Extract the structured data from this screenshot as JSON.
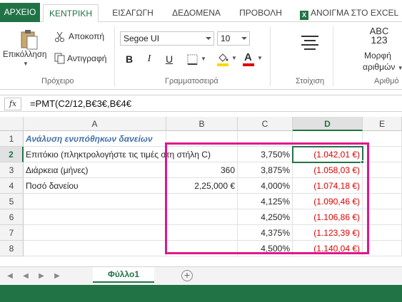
{
  "tabs": {
    "file": "ΑΡΧΕΙΟ",
    "home": "ΚΕΝΤΡΙΚΗ",
    "insert": "ΕΙΣΑΓΩΓΗ",
    "data": "ΔΕΔΟΜΕΝΑ",
    "view": "ΠΡΟΒΟΛΗ",
    "open_in_excel": "ΑΝΟΙΓΜΑ ΣΤΟ EXCEL"
  },
  "ribbon": {
    "clipboard": {
      "paste_label": "Επικόλληση",
      "cut_label": "Αποκοπή",
      "copy_label": "Αντιγραφή",
      "group_label": "Πρόχειρο"
    },
    "font": {
      "font_name": "Segoe UI",
      "font_size": "10",
      "bold": "B",
      "italic": "I",
      "underline": "U",
      "font_color_glyph": "A",
      "group_label": "Γραμματοσειρά"
    },
    "alignment": {
      "group_label": "Στοίχιση"
    },
    "number": {
      "icon_text_top": "ABC",
      "icon_text_bottom": "123",
      "format_label_1": "Μορφή",
      "format_label_2": "αριθμών",
      "group_label": "Αριθμό"
    },
    "colors": {
      "accent": "#217346",
      "highlight": "#ffd700",
      "font_color": "#e00000"
    }
  },
  "formula_bar": {
    "fx": "fx",
    "formula": "=PMT(C2/12,B€3€,B€4€"
  },
  "sheet": {
    "columns": [
      "A",
      "B",
      "C",
      "D",
      "E"
    ],
    "rows": [
      "1",
      "2",
      "3",
      "4",
      "5",
      "6",
      "7",
      "8"
    ],
    "active_column": "D",
    "active_row": "2",
    "cells": {
      "a1": "Ανάλυση ενυπόθηκων δανείων",
      "a2": "Επιτόκιο (πληκτρολογήστε τις τιμές στη στήλη C)",
      "a3": "Διάρκεια (μήνες)",
      "a4": "Ποσό δανείου",
      "b3": "360",
      "b4": "2,25,000 €",
      "c2": "3,750%",
      "c3": "3,875%",
      "c4": "4,000%",
      "c5": "4,125%",
      "c6": "4,250%",
      "c7": "4,375%",
      "c8": "4,500%",
      "d2": "(1.042,01 €)",
      "d3": "(1.058,03 €)",
      "d4": "(1.074,18 €)",
      "d5": "(1.090,46 €)",
      "d6": "(1.106,86 €)",
      "d7": "(1.123,39 €)",
      "d8": "(1.140,04 €)"
    },
    "highlight_color": "#e0168c"
  },
  "sheet_tabs": {
    "active": "Φύλλο1",
    "add_glyph": "+"
  }
}
